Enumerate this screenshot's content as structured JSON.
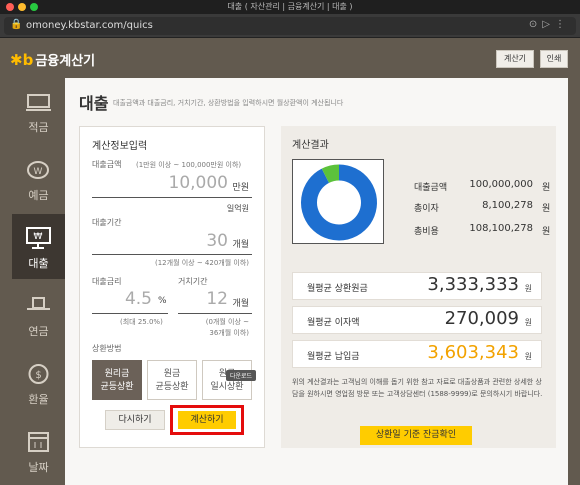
{
  "window": {
    "title": "대출 ( 자산관리 | 금융계산기 | 대출 )"
  },
  "browser": {
    "url": "omoney.kbstar.com/quics"
  },
  "header": {
    "logo_mark": "✱b",
    "logo_text": "금융계산기",
    "calc_button": "계산기",
    "print_button": "인쇄"
  },
  "sidebar": {
    "items": [
      {
        "label": "적금",
        "icon": "savings-icon"
      },
      {
        "label": "예금",
        "icon": "piggy-bank-icon"
      },
      {
        "label": "대출",
        "icon": "monitor-won-icon",
        "active": true
      },
      {
        "label": "연금",
        "icon": "hat-icon"
      },
      {
        "label": "환율",
        "icon": "exchange-icon"
      },
      {
        "label": "날짜",
        "icon": "calendar-icon"
      }
    ]
  },
  "page": {
    "title": "대출",
    "description": "대출금액과 대출금리, 거치기간, 상환방법을 입력하시면 월상환액이 계산됩니다"
  },
  "input": {
    "section_title": "계산정보입력",
    "amount": {
      "label": "대출금액",
      "hint": "(1만원 이상 ~ 100,000만원 이하)",
      "value": "10,000",
      "unit": "만원",
      "readout": "일억원"
    },
    "period": {
      "label": "대출기간",
      "value": "30",
      "unit": "개월",
      "hint": "(12개월 이상 ~ 420개월 이하)"
    },
    "rate": {
      "label": "대출금리",
      "value": "4.5",
      "unit": "%",
      "hint": "(최대 25.0%)"
    },
    "grace": {
      "label": "거치기간",
      "value": "12",
      "unit": "개월",
      "hint1": "(0개월 이상 ~",
      "hint2": "36개월 이하)"
    },
    "method": {
      "label": "상환방법",
      "options": [
        {
          "line1": "원리금",
          "line2": "균등상환",
          "selected": true
        },
        {
          "line1": "원금",
          "line2": "균등상환",
          "selected": false
        },
        {
          "line1": "원금",
          "line2": "일시상환",
          "selected": false
        }
      ],
      "tooltip": "다운로드"
    },
    "reset_button": "다시하기",
    "calc_button": "계산하기"
  },
  "result": {
    "section_title": "계산결과",
    "chart_data": {
      "type": "pie",
      "donut": true,
      "categories": [
        "대출금액",
        "총이자"
      ],
      "values": [
        100000000,
        8100278
      ],
      "colors": [
        "#1e6fd0",
        "#5cc23b"
      ]
    },
    "summary": [
      {
        "label": "대출금액",
        "value": "100,000,000",
        "unit": "원"
      },
      {
        "label": "총이자",
        "value": "8,100,278",
        "unit": "원"
      },
      {
        "label": "총비용",
        "value": "108,100,278",
        "unit": "원"
      }
    ],
    "monthly": [
      {
        "label": "월평균 상환원금",
        "value": "3,333,333",
        "unit": "원",
        "color": "#333333"
      },
      {
        "label": "월평균 이자액",
        "value": "270,009",
        "unit": "원",
        "color": "#333333"
      },
      {
        "label": "월평균 납입금",
        "value": "3,603,343",
        "unit": "원",
        "color": "#f2a200"
      }
    ],
    "note": "위의 계산결과는 고객님의 이해를 돕기 위한 참고 자료로 대출상품과 관련한 상세한 상담을 원하시면 영업점 방문 또는 고객상담센터 (1588-9999)로 문의하시기 바랍니다.",
    "check_button": "상환일 기준 잔금확인"
  }
}
